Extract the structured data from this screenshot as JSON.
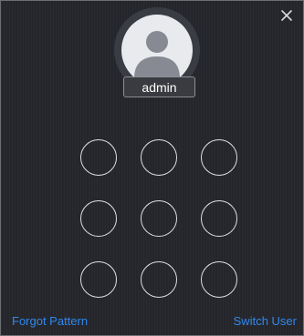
{
  "dialog": {
    "user": {
      "name": "admin"
    },
    "pattern": {
      "rows": 3,
      "cols": 3
    },
    "footer": {
      "forgot_label": "Forgot Pattern",
      "switch_label": "Switch User"
    },
    "colors": {
      "background": "#26272c",
      "link": "#2f88f0",
      "dot_stroke": "#dfe0e3"
    },
    "icons": [
      "close-icon",
      "user-avatar-icon"
    ]
  }
}
